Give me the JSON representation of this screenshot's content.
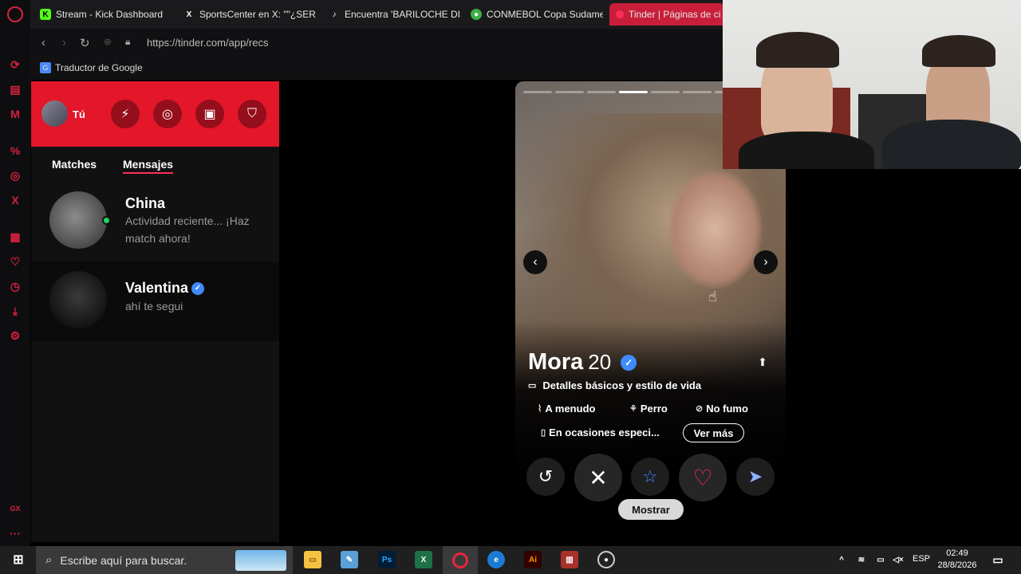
{
  "browser": {
    "tabs": [
      {
        "title": "Stream - Kick Dashboard",
        "icon": "kick-icon",
        "color": "#53fc18"
      },
      {
        "title": "SportsCenter en X: \"\"¿SER",
        "icon": "x-icon",
        "color": "#ffffff"
      },
      {
        "title": "Encuentra 'BARILOCHE DIS",
        "icon": "tiktok-icon",
        "color": "#ffffff"
      },
      {
        "title": "CONMEBOL Copa Sudame",
        "icon": "conmebol-icon",
        "color": "#3cb043"
      },
      {
        "title": "Tinder | Páginas de ci",
        "icon": "tinder-icon",
        "color": "#fd2d5a"
      }
    ],
    "url": "https://tinder.com/app/recs",
    "bookmark": "Traductor de Google"
  },
  "sidebar": {
    "me_label": "Tú",
    "tabs": {
      "matches": "Matches",
      "messages": "Mensajes"
    },
    "conversations": [
      {
        "name": "China",
        "message": "Actividad reciente... ¡Haz match ahora!",
        "online": true,
        "verified": false
      },
      {
        "name": "Valentina",
        "message": "ahí te segui",
        "online": false,
        "verified": true
      }
    ]
  },
  "profile": {
    "name": "Mora",
    "age": "20",
    "verified": true,
    "photo_count": 7,
    "current_photo": 4,
    "details_label": "Detalles básicos y estilo de vida",
    "chips": [
      {
        "icon": "drink-icon",
        "label": "A menudo"
      },
      {
        "icon": "paw-icon",
        "label": "Perro"
      },
      {
        "icon": "no-smoking-icon",
        "label": "No fumo"
      },
      {
        "icon": "bottle-icon",
        "label": "En ocasiones especi..."
      }
    ],
    "see_more": "Ver más",
    "tooltip": "Mostrar"
  },
  "taskbar": {
    "search_placeholder": "Escribe aquí para buscar.",
    "language": "ESP",
    "time": "02:49",
    "date": "28/8/2026"
  }
}
